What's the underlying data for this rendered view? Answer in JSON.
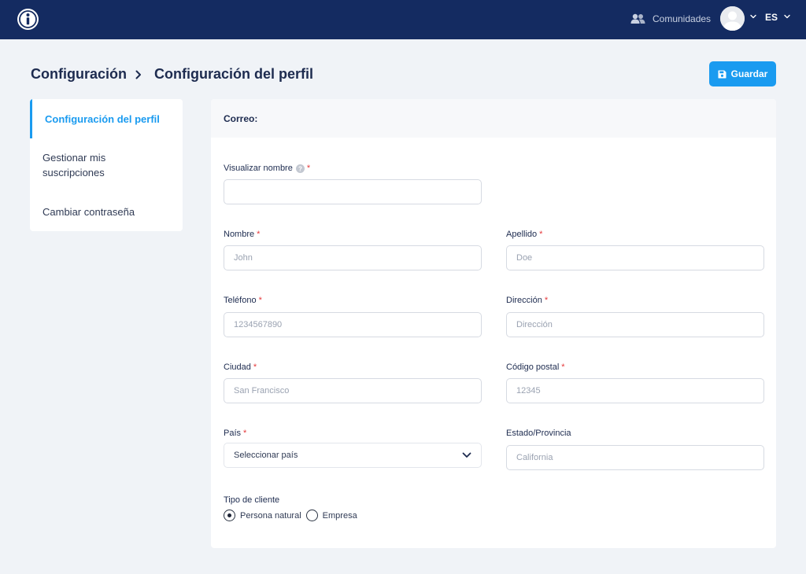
{
  "topbar": {
    "logo_icon": "info-circle-icon",
    "communities_icon": "users-icon",
    "communities_label": "Comunidades",
    "avatar_icon": "user-avatar-icon",
    "language": "ES"
  },
  "header": {
    "breadcrumb_parent": "Configuración",
    "breadcrumb_current": "Configuración del perfil",
    "save_label": "Guardar"
  },
  "sidebar": {
    "items": [
      {
        "label": "Configuración del perfil",
        "active": true
      },
      {
        "label": "Gestionar mis suscripciones",
        "active": false
      },
      {
        "label": "Cambiar contraseña",
        "active": false
      }
    ]
  },
  "form": {
    "section_title": "Correo:",
    "display_name": {
      "label": "Visualizar nombre",
      "value": "",
      "placeholder": ""
    },
    "first_name": {
      "label": "Nombre",
      "value": "",
      "placeholder": "John"
    },
    "last_name": {
      "label": "Apellido",
      "value": "",
      "placeholder": "Doe"
    },
    "phone": {
      "label": "Teléfono",
      "value": "",
      "placeholder": "1234567890"
    },
    "address": {
      "label": "Dirección",
      "value": "",
      "placeholder": "Dirección"
    },
    "city": {
      "label": "Ciudad",
      "value": "",
      "placeholder": "San Francisco"
    },
    "postal_code": {
      "label": "Código postal",
      "value": "",
      "placeholder": "12345"
    },
    "country": {
      "label": "País",
      "selected": "Seleccionar país"
    },
    "state": {
      "label": "Estado/Provincia",
      "value": "",
      "placeholder": "California"
    },
    "customer_type": {
      "label": "Tipo de cliente",
      "options": [
        "Persona natural",
        "Empresa"
      ],
      "selected": "Persona natural"
    },
    "required_marker": "*"
  },
  "colors": {
    "topbar": "#142b61",
    "accent": "#1a9bf0",
    "required": "#e5393b",
    "background": "#f0f3f7"
  }
}
